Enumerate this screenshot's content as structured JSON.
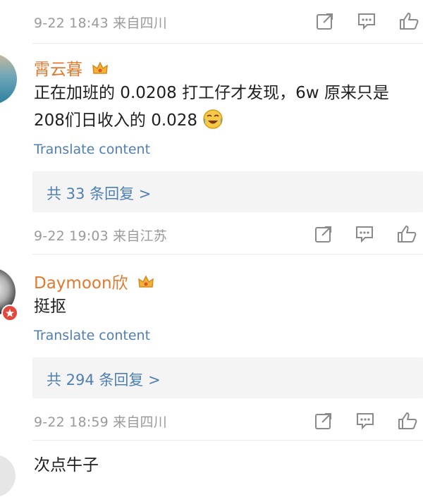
{
  "comments": [
    {
      "meta": "9-22 18:43 来自四川"
    },
    {
      "username": "霄云暮",
      "content_lines": [
        "正在加班的 0.0208 打工仔才发现，6w 原来只是",
        "208们日收入的 0.028"
      ],
      "translate": "Translate content",
      "replies": "共 33 条回复 >",
      "meta": "9-22 19:03 来自江苏"
    },
    {
      "username": "Daymoon欣",
      "content_lines": [
        "挺抠"
      ],
      "translate": "Translate content",
      "replies": "共 294 条回复 >",
      "meta": "9-22 18:59 来自四川"
    },
    {
      "content_lines": [
        "次点牛子"
      ]
    }
  ],
  "icons": [
    "share-icon",
    "comment-icon",
    "like-icon",
    "crown-badge-icon",
    "laugh-cry-emoji-icon"
  ]
}
